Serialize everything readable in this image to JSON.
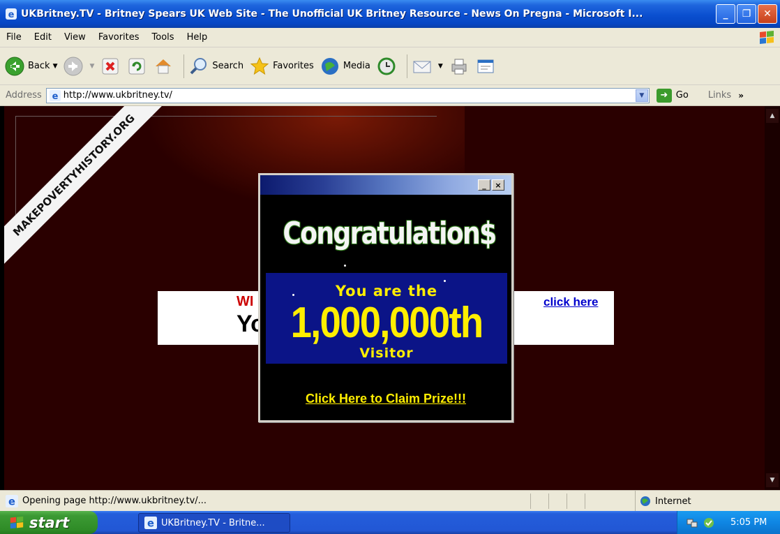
{
  "window": {
    "title": "UKBritney.TV - Britney Spears UK Web Site - The Unofficial UK Britney Resource - News On Pregna - Microsoft I...",
    "buttons": [
      "minimize",
      "restore",
      "close"
    ]
  },
  "menu": {
    "items": [
      "File",
      "Edit",
      "View",
      "Favorites",
      "Tools",
      "Help"
    ]
  },
  "toolbar": {
    "back": "Back",
    "search": "Search",
    "favorites": "Favorites",
    "media": "Media"
  },
  "address": {
    "label": "Address",
    "url": "http://www.ukbritney.tv/",
    "go": "Go",
    "links": "Links",
    "links_more": "»"
  },
  "page": {
    "banner": "MAKEPOVERTYHISTORY.ORG",
    "box_red_text": "WI",
    "box_black_text": "Yo",
    "click_here": "click here",
    "background_color": "#2a0000"
  },
  "popup": {
    "title_buttons": [
      "_",
      "×"
    ],
    "congrats": "Congratulation$",
    "you_are": "You are the",
    "milestone": "1,000,000th",
    "visitor": "Visitor",
    "claim": "Click Here to Claim Prize!!!",
    "accent_color": "#ffee00",
    "prize_bg": "#0b1487"
  },
  "status": {
    "text": "Opening page http://www.ukbritney.tv/...",
    "zone": "Internet"
  },
  "taskbar": {
    "start": "start",
    "task_item": "UKBritney.TV - Britne...",
    "clock": "5:05 PM"
  }
}
